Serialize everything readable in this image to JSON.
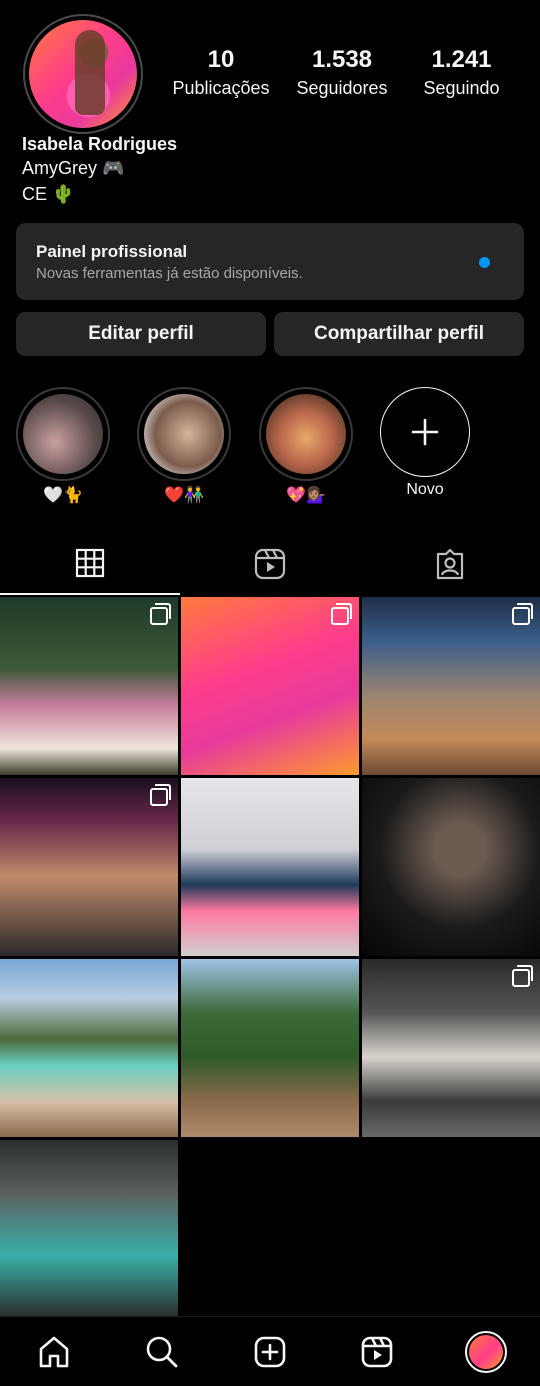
{
  "profile": {
    "stats": [
      {
        "value": "10",
        "label": "Publicações"
      },
      {
        "value": "1.538",
        "label": "Seguidores"
      },
      {
        "value": "1.241",
        "label": "Seguindo"
      }
    ],
    "name": "Isabela Rodrigues",
    "bio_line1": "AmyGrey 🎮",
    "bio_line2": "CE 🌵"
  },
  "pro_panel": {
    "title": "Painel profissional",
    "subtitle": "Novas ferramentas já estão disponíveis.",
    "dot_color": "#0095f6"
  },
  "actions": {
    "edit_label": "Editar perfil",
    "share_label": "Compartilhar perfil"
  },
  "highlights": [
    {
      "label": "🤍🐈"
    },
    {
      "label": "❤️👫"
    },
    {
      "label": "💖💁🏽‍♀️"
    },
    {
      "label": "Novo"
    }
  ],
  "tabs": [
    "grid-icon",
    "reels-icon",
    "tagged-icon"
  ],
  "posts": [
    {
      "multi": true
    },
    {
      "multi": true
    },
    {
      "multi": true
    },
    {
      "multi": true
    },
    {
      "multi": false
    },
    {
      "multi": false
    },
    {
      "multi": false
    },
    {
      "multi": false
    },
    {
      "multi": true
    },
    {
      "multi": false
    }
  ],
  "nav": [
    "home-icon",
    "search-icon",
    "create-icon",
    "reels-icon",
    "profile-avatar"
  ],
  "colors": {
    "background": "#000000",
    "surface": "#262626",
    "accent": "#0095f6"
  }
}
